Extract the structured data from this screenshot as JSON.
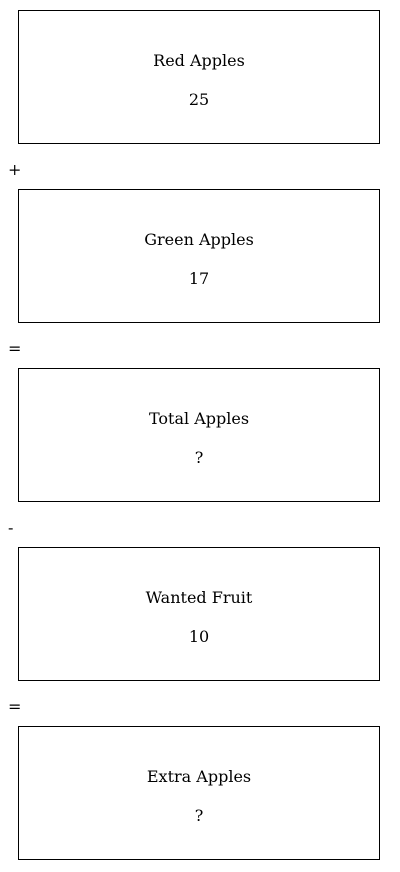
{
  "boxes": [
    {
      "label": "Red Apples",
      "value": "25"
    },
    {
      "label": "Green Apples",
      "value": "17"
    },
    {
      "label": "Total Apples",
      "value": "?"
    },
    {
      "label": "Wanted Fruit",
      "value": "10"
    },
    {
      "label": "Extra Apples",
      "value": "?"
    }
  ],
  "operators": [
    "+",
    "=",
    "-",
    "="
  ]
}
